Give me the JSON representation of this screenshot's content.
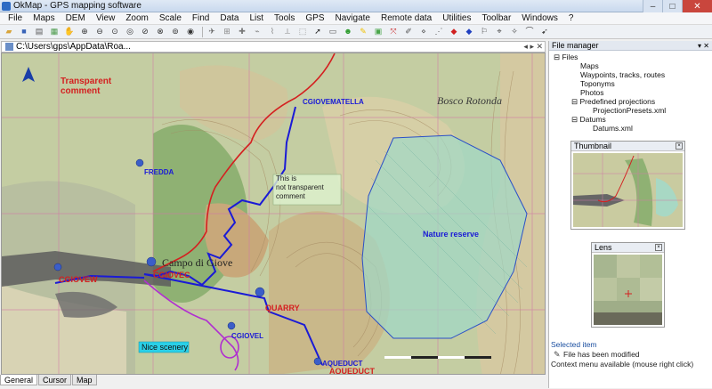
{
  "window": {
    "title": "OkMap - GPS mapping software",
    "minimize": "–",
    "maximize": "□",
    "close": "✕"
  },
  "menu": [
    "File",
    "Maps",
    "DEM",
    "View",
    "Zoom",
    "Scale",
    "Find",
    "Data",
    "List",
    "Tools",
    "GPS",
    "Navigate",
    "Remote data",
    "Utilities",
    "Toolbar",
    "Windows",
    "?"
  ],
  "document": {
    "path": "C:\\Users\\gps\\AppData\\Roa...",
    "controls": "◂ ▸ ✕"
  },
  "map_labels": {
    "transparent_comment": "Transparent\ncomment",
    "cgiovematella": "CGIOVEMATELLA",
    "bosco_rotonda": "Bosco Rotonda",
    "fredda": "FREDDA",
    "not_transparent_comment": "This is\nnot transparent\ncomment",
    "nature_reserve": "Nature reserve",
    "campo_di_giove": "Campo di Giove",
    "cgioview": "CGIOVEW",
    "cgiovec": "CGIOVEC",
    "quarry": "QUARRY",
    "cgiovel": "CGIOVEL",
    "nice_scenery": "Nice scenery",
    "aqueduct": "AQUEDUCT",
    "aqueduct_red": "AQUEDUCT"
  },
  "file_manager": {
    "title": "File manager",
    "root": "Files",
    "items": [
      "Maps",
      "Waypoints, tracks, routes",
      "Toponyms",
      "Photos",
      "Predefined projections",
      "ProjectionPresets.xml",
      "Datums",
      "Datums.xml"
    ]
  },
  "thumbnail": {
    "title": "Thumbnail"
  },
  "lens": {
    "title": "Lens"
  },
  "status": {
    "selected_item": "Selected item",
    "file_modified": "File has been modified",
    "context_menu": "Context menu available (mouse right click)"
  },
  "bottom_tabs": [
    "General",
    "Cursor",
    "Map"
  ],
  "colors": {
    "map_base": "#c5cfa4",
    "route_blue": "#1a1ad6",
    "route_red": "#d42020",
    "reserve_fill": "#9fd8c8",
    "reserve_border": "#2a4fc8"
  }
}
